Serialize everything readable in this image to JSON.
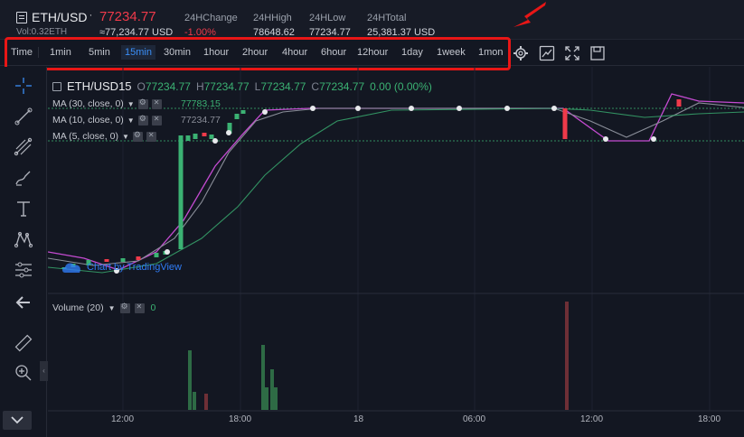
{
  "ticker": {
    "pair": "ETH/USD",
    "pair_sup": "'",
    "volume": "Vol:0.32ETH",
    "last_price": "77234.77",
    "converted": "≈77,234.77 USD",
    "stats": [
      {
        "label": "24HChange",
        "value": "-1.00%",
        "color": "red"
      },
      {
        "label": "24HHigh",
        "value": "78648.62",
        "color": "normal"
      },
      {
        "label": "24HLow",
        "value": "77234.77",
        "color": "normal"
      },
      {
        "label": "24HTotal",
        "value": "25,381.37 USD",
        "color": "normal"
      }
    ]
  },
  "timeframes": [
    "Time",
    "1min",
    "5min",
    "15min",
    "30min",
    "1hour",
    "2hour",
    "4hour",
    "6hour",
    "12hour",
    "1day",
    "1week",
    "1mon"
  ],
  "active_timeframe": "15min",
  "top_tools": [
    "settings-icon",
    "indicators-icon",
    "fullscreen-icon",
    "save-icon"
  ],
  "left_tools": [
    "crosshair-icon",
    "trend-line-icon",
    "fib-icon",
    "brush-icon",
    "text-icon",
    "pattern-icon",
    "position-icon",
    "back-arrow-icon",
    "ruler-icon",
    "zoom-icon"
  ],
  "legend": {
    "symbol": "ETH/USD",
    "interval": "15",
    "open_label": "O",
    "open": "77234.77",
    "high_label": "H",
    "high": "77234.77",
    "low_label": "L",
    "low": "77234.77",
    "close_label": "C",
    "close": "77234.77",
    "change": "0.00 (0.00%)"
  },
  "moving_averages": [
    {
      "label": "MA (30, close, 0)",
      "value": "77783.15",
      "color": "#3bb273"
    },
    {
      "label": "MA (10, close, 0)",
      "value": "77234.77",
      "color": "#8a8e99"
    },
    {
      "label": "MA (5, close, 0)",
      "value": "",
      "color": "#c44bd1"
    }
  ],
  "volume_indicator": {
    "label": "Volume (20)",
    "value": "0"
  },
  "watermark": "Chart by TradingView",
  "time_axis": [
    "12:00",
    "18:00",
    "18",
    "06:00",
    "12:00",
    "18:00"
  ],
  "colors": {
    "up": "#3bb273",
    "down": "#ef3a4a",
    "accent": "#3a8ef6",
    "annotation": "#e81616"
  },
  "chart_data": {
    "type": "line",
    "title": "",
    "series": [
      {
        "name": "MA (5, close, 0)",
        "values": []
      },
      {
        "name": "MA (10, close, 0)",
        "values": []
      },
      {
        "name": "MA (30, close, 0)",
        "values": []
      }
    ]
  }
}
